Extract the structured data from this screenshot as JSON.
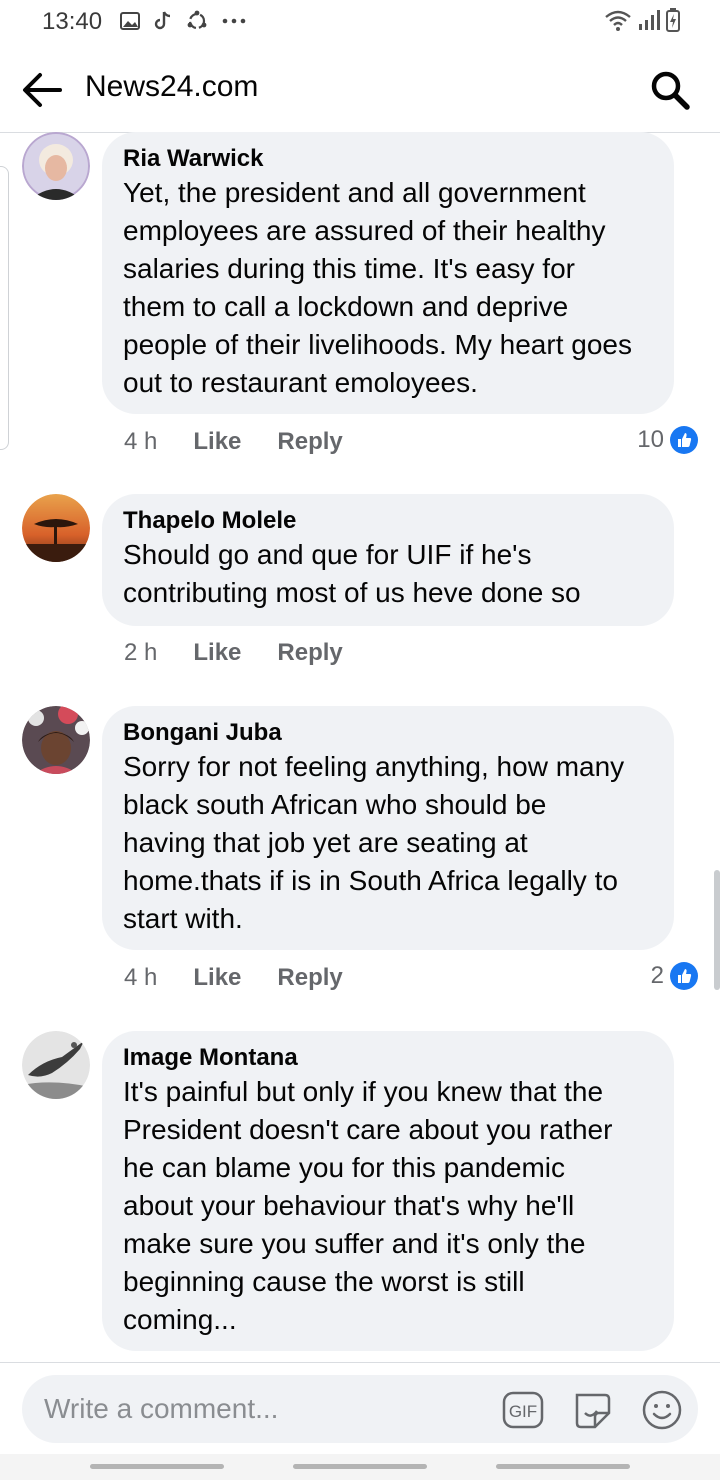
{
  "status_bar": {
    "time": "13:40"
  },
  "header": {
    "title": "News24.com"
  },
  "comments": [
    {
      "author": "Ria Warwick",
      "text": "Yet, the president and all government\nemployees are assured of their healthy\nsalaries during this time. It's easy for\nthem to call a lockdown and deprive\npeople of their livelihoods. My heart goes\nout to restaurant emoloyees.",
      "time": "4 h",
      "like": "Like",
      "reply": "Reply",
      "reactions": "10"
    },
    {
      "author": "Thapelo Molele",
      "text": "Should go and que for UIF if he's\ncontributing most of us heve done so",
      "time": "2 h",
      "like": "Like",
      "reply": "Reply",
      "reactions": ""
    },
    {
      "author": "Bongani Juba",
      "text": "Sorry for not feeling anything, how many\nblack south African who should be\nhaving that job yet are seating at\nhome.thats if is in South Africa legally to\nstart with.",
      "time": "4 h",
      "like": "Like",
      "reply": "Reply",
      "reactions": "2"
    },
    {
      "author": "Image Montana",
      "text": "It's painful but only if you knew that the\nPresident doesn't care about you rather\nhe can blame you for this pandemic\nabout your behaviour that's why he'll\nmake sure you suffer and it's only the\nbeginning cause the worst is still\ncoming...",
      "time": "",
      "like": "",
      "reply": "",
      "reactions": ""
    }
  ],
  "composer": {
    "placeholder": "Write a comment...",
    "gif_label": "GIF"
  },
  "icons": {
    "back": "arrow-left-icon",
    "search": "search-icon",
    "gif": "gif-icon",
    "sticker": "sticker-icon",
    "emoji": "emoji-icon",
    "reaction": "thumbs-up-icon"
  },
  "colors": {
    "accent": "#1877f2",
    "bubble": "#f0f2f5",
    "meta": "#65676b"
  }
}
